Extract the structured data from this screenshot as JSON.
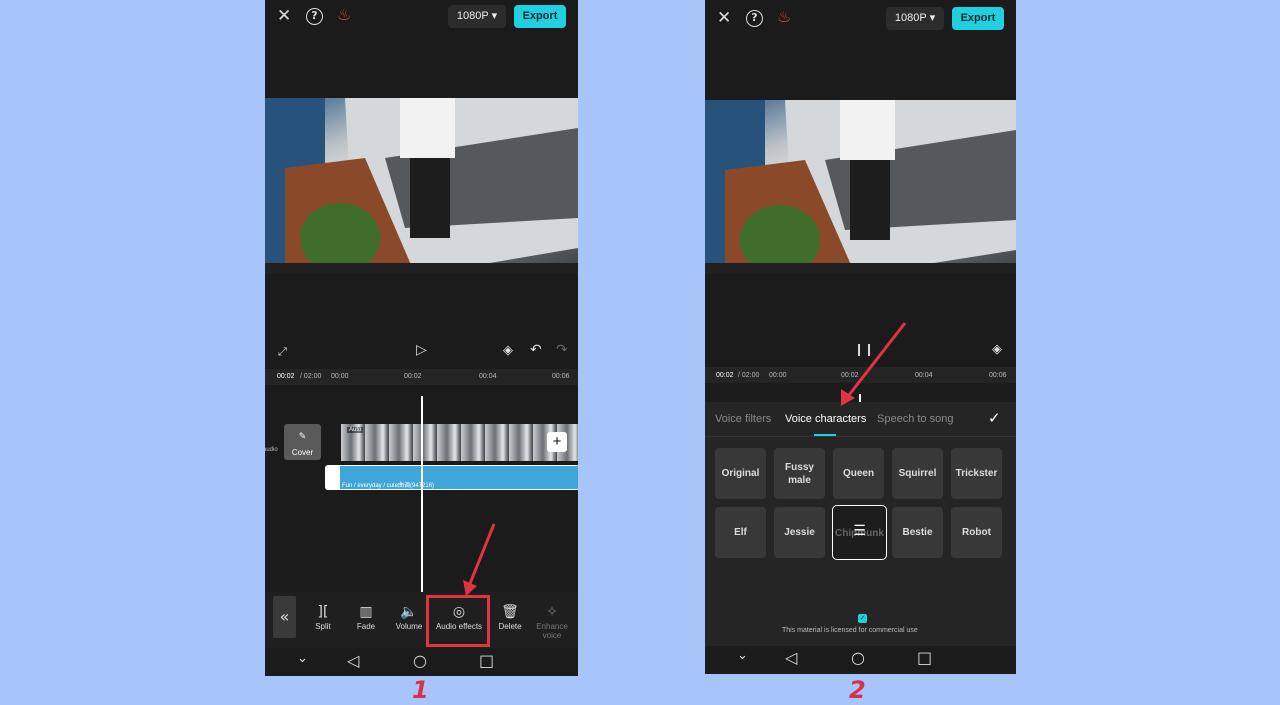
{
  "colors": {
    "page_bg": "#a7c4fb",
    "accent": "#1fd0e0",
    "highlight": "#e0343f"
  },
  "left": {
    "top_bar": {
      "resolution": "1080P ▾",
      "export": "Export"
    },
    "timeline": {
      "current": "00:02",
      "total": "/ 02:00",
      "t0": "00:00",
      "t2": "00:02",
      "t4": "00:04",
      "t6": "00:06",
      "track_label": "audio",
      "cover": "Cover",
      "clip_tag": "Auto",
      "audio_title": "Fun / everyday / cute曲调(947216)"
    },
    "tools": [
      "Split",
      "Fade",
      "Volume",
      "Audio effects",
      "Delete",
      "Enhance voice"
    ],
    "step": "1"
  },
  "right": {
    "top_bar": {
      "resolution": "1080P ▾",
      "export": "Export"
    },
    "timeline": {
      "current": "00:02",
      "total": "/ 02:00",
      "t0": "00:00",
      "t2": "00:02",
      "t4": "00:04",
      "t6": "00:06"
    },
    "tabs": [
      "Voice filters",
      "Voice characters",
      "Speech to song"
    ],
    "voices_row1": [
      "Original",
      "Fussy male",
      "Queen",
      "Squirrel",
      "Trickster"
    ],
    "voices_row2": [
      "Elf",
      "Jessie",
      "Chipmunk",
      "Bestie",
      "Robot"
    ],
    "license": "This material is licensed for commercial use",
    "step": "2"
  }
}
